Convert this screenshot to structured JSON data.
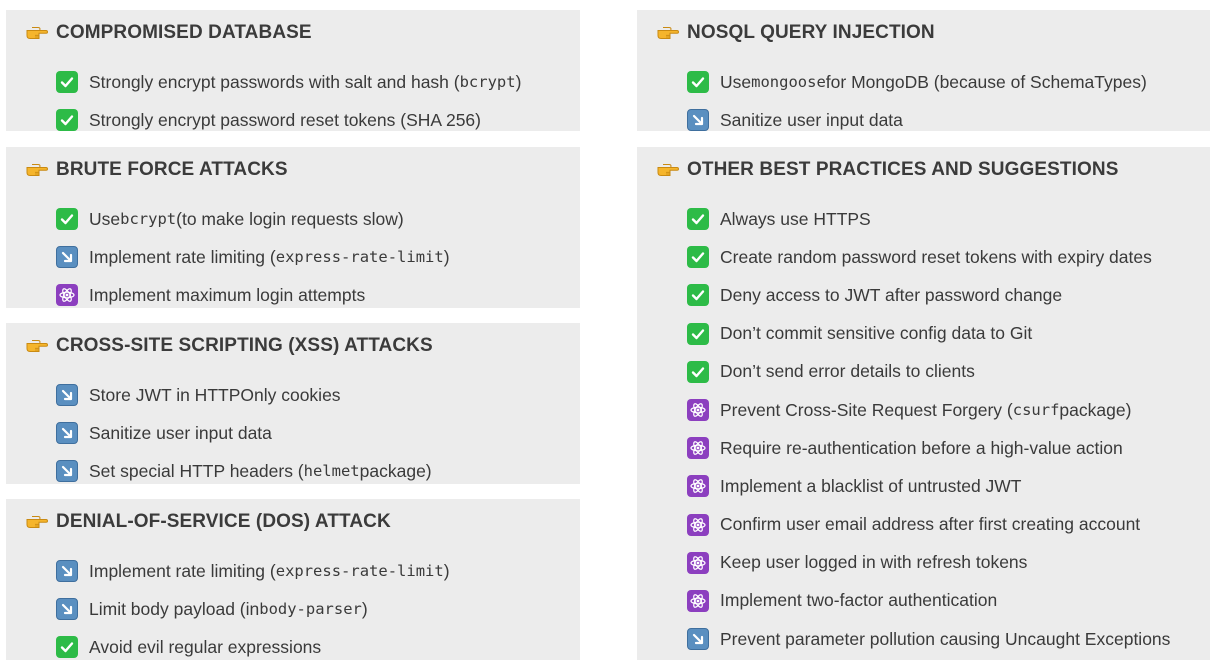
{
  "colors": {
    "card_bg": "#ececec",
    "check": "#2dbb47",
    "arrow": "#5a8fc0",
    "atom": "#8c3fbf",
    "hand": "#f5b52c"
  },
  "sections": [
    {
      "title": "COMPROMISED DATABASE",
      "items": [
        {
          "icon": "check-icon",
          "text": "Strongly encrypt passwords with salt and hash (",
          "code": "bcrypt",
          "after": ")"
        },
        {
          "icon": "check-icon",
          "text": "Strongly encrypt password reset tokens (SHA 256)",
          "code": "",
          "after": ""
        }
      ]
    },
    {
      "title": "BRUTE FORCE ATTACKS",
      "items": [
        {
          "icon": "check-icon",
          "text": "Use ",
          "code": "bcrypt",
          "after": " (to make login requests slow)"
        },
        {
          "icon": "arrow-icon",
          "text": "Implement rate limiting (",
          "code": "express-rate-limit",
          "after": ")"
        },
        {
          "icon": "atom-icon",
          "text": "Implement maximum login attempts",
          "code": "",
          "after": ""
        }
      ]
    },
    {
      "title": "CROSS-SITE SCRIPTING (XSS) ATTACKS",
      "items": [
        {
          "icon": "arrow-icon",
          "text": "Store JWT in HTTPOnly cookies",
          "code": "",
          "after": ""
        },
        {
          "icon": "arrow-icon",
          "text": "Sanitize user input data",
          "code": "",
          "after": ""
        },
        {
          "icon": "arrow-icon",
          "text": "Set special HTTP headers (",
          "code": "helmet",
          "after": " package)"
        }
      ]
    },
    {
      "title": "DENIAL-OF-SERVICE (DOS) ATTACK",
      "items": [
        {
          "icon": "arrow-icon",
          "text": "Implement rate limiting (",
          "code": "express-rate-limit",
          "after": ")"
        },
        {
          "icon": "arrow-icon",
          "text": "Limit body payload (in ",
          "code": "body-parser",
          "after": ")"
        },
        {
          "icon": "check-icon",
          "text": "Avoid evil regular expressions",
          "code": "",
          "after": ""
        }
      ]
    },
    {
      "title": "NOSQL QUERY INJECTION",
      "items": [
        {
          "icon": "check-icon",
          "text": "Use ",
          "code": "mongoose",
          "after": " for MongoDB (because of SchemaTypes)"
        },
        {
          "icon": "arrow-icon",
          "text": "Sanitize user input data",
          "code": "",
          "after": ""
        }
      ]
    },
    {
      "title": "OTHER BEST PRACTICES AND SUGGESTIONS",
      "items": [
        {
          "icon": "check-icon",
          "text": "Always use HTTPS",
          "code": "",
          "after": ""
        },
        {
          "icon": "check-icon",
          "text": "Create random password reset tokens with expiry dates",
          "code": "",
          "after": ""
        },
        {
          "icon": "check-icon",
          "text": "Deny access to JWT after password change",
          "code": "",
          "after": ""
        },
        {
          "icon": "check-icon",
          "text": "Don’t commit sensitive config data to Git",
          "code": "",
          "after": ""
        },
        {
          "icon": "check-icon",
          "text": "Don’t send error details to clients",
          "code": "",
          "after": ""
        },
        {
          "icon": "atom-icon",
          "text": "Prevent Cross-Site Request Forgery (",
          "code": "csurf",
          "after": " package)"
        },
        {
          "icon": "atom-icon",
          "text": "Require re-authentication before a high-value action",
          "code": "",
          "after": ""
        },
        {
          "icon": "atom-icon",
          "text": "Implement a blacklist of untrusted JWT",
          "code": "",
          "after": ""
        },
        {
          "icon": "atom-icon",
          "text": "Confirm user email address after first creating account",
          "code": "",
          "after": ""
        },
        {
          "icon": "atom-icon",
          "text": "Keep user logged in with refresh tokens",
          "code": "",
          "after": ""
        },
        {
          "icon": "atom-icon",
          "text": "Implement two-factor authentication",
          "code": "",
          "after": ""
        },
        {
          "icon": "arrow-icon",
          "text": "Prevent parameter pollution causing Uncaught Exceptions",
          "code": "",
          "after": ""
        }
      ]
    }
  ]
}
